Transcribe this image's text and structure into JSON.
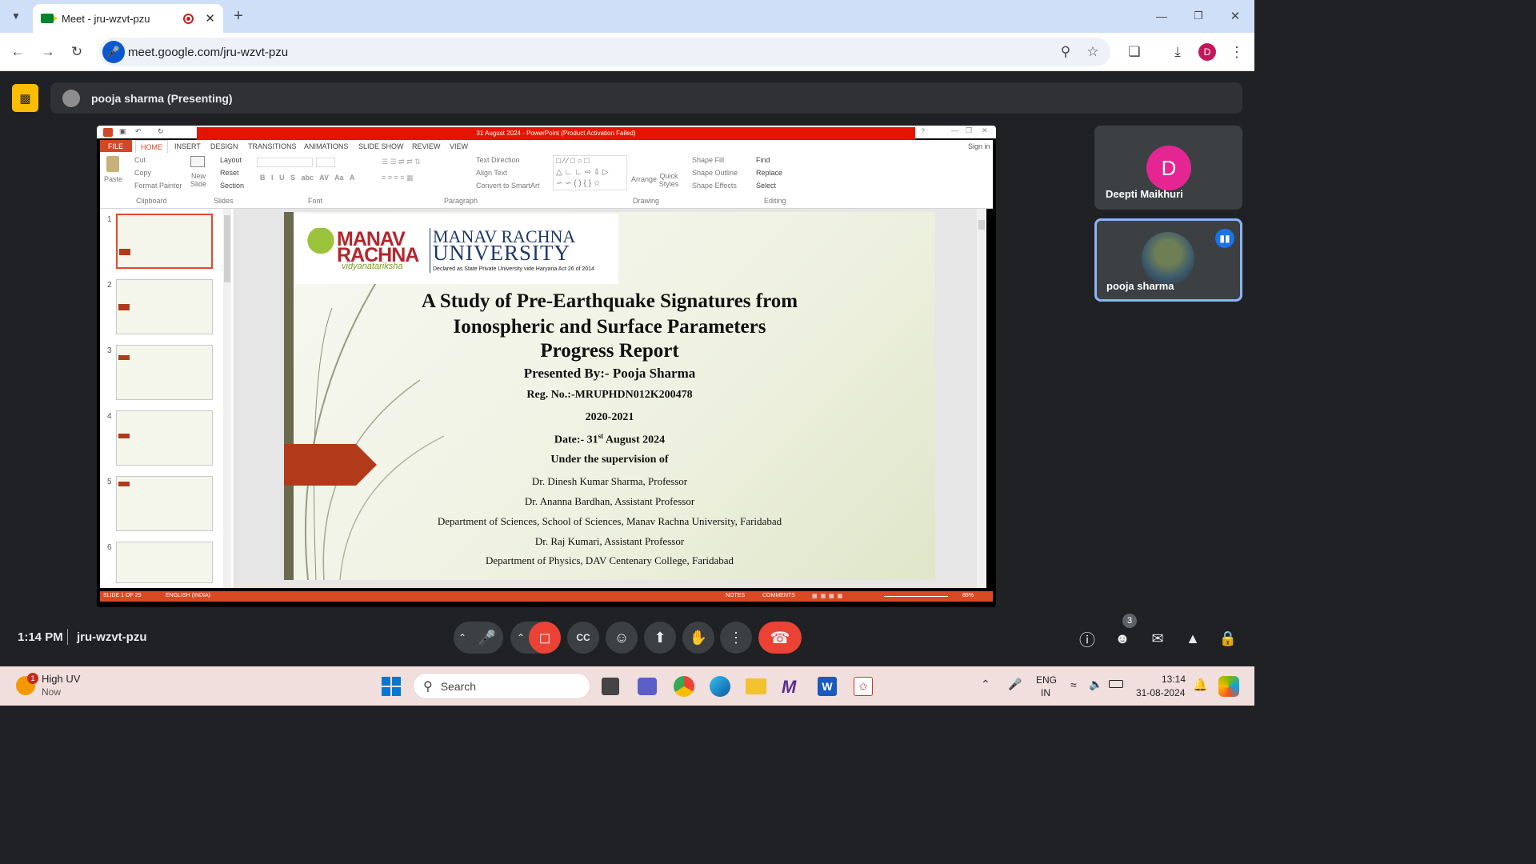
{
  "browser": {
    "tab_title": "Meet - jru-wzvt-pzu",
    "url": "meet.google.com/jru-wzvt-pzu",
    "profile_initial": "D",
    "new_tab": "+"
  },
  "meet": {
    "presenter_label": "pooja sharma (Presenting)",
    "time": "1:14 PM",
    "meeting_code": "jru-wzvt-pzu",
    "participant_count": "3",
    "participants": [
      {
        "name": "Deepti Maikhuri",
        "initial": "D",
        "color": "#e52592"
      },
      {
        "name": "pooja sharma"
      }
    ]
  },
  "powerpoint": {
    "window_title": "31 August  2024 - PowerPoint (Product Activation Failed)",
    "sign_in": "Sign in",
    "tabs": [
      "FILE",
      "HOME",
      "INSERT",
      "DESIGN",
      "TRANSITIONS",
      "ANIMATIONS",
      "SLIDE SHOW",
      "REVIEW",
      "VIEW"
    ],
    "clipboard": {
      "paste": "Paste",
      "cut": "Cut",
      "copy": "Copy",
      "format_painter": "Format Painter",
      "group": "Clipboard"
    },
    "slides_group": {
      "new_slide": "New Slide",
      "layout": "Layout",
      "reset": "Reset",
      "section": "Section",
      "group": "Slides"
    },
    "font_group": "Font",
    "paragraph": {
      "text_direction": "Text Direction",
      "align_text": "Align Text",
      "convert": "Convert to SmartArt",
      "group": "Paragraph"
    },
    "drawing": {
      "arrange": "Arrange",
      "quick_styles": "Quick Styles",
      "shape_fill": "Shape Fill",
      "shape_outline": "Shape Outline",
      "shape_effects": "Shape Effects",
      "group": "Drawing"
    },
    "editing": {
      "find": "Find",
      "replace": "Replace",
      "select": "Select",
      "group": "Editing"
    },
    "thumb_numbers": [
      "1",
      "2",
      "3",
      "4",
      "5",
      "6"
    ],
    "status": {
      "slide": "SLIDE 1 OF 29",
      "language": "ENGLISH (INDIA)",
      "notes": "NOTES",
      "comments": "COMMENTS",
      "zoom": "88%"
    }
  },
  "slide": {
    "logo_left_1": "MANAV",
    "logo_left_2": "RACHNA",
    "logo_tagline": "vidyanatariksha",
    "logo_right_1": "MANAV RACHNA",
    "logo_right_2": "UNIVERSITY",
    "logo_caption": "Declared as State Private University vide Haryana Act 26 of 2014",
    "title_1": "A Study of Pre-Earthquake Signatures from",
    "title_2": "Ionospheric and Surface Parameters",
    "subtitle": "Progress Report",
    "presented_by": "Presented By:- Pooja Sharma",
    "reg_no": "Reg. No.:-MRUPHDN012K200478",
    "year": "2020-2021",
    "date_prefix": "Date:- 31",
    "date_sup": "st",
    "date_suffix": " August 2024",
    "supervision": "Under the supervision of",
    "line_1": "Dr. Dinesh Kumar Sharma, Professor",
    "line_2": "Dr. Ananna Bardhan, Assistant Professor",
    "line_3": "Department of Sciences, School of Sciences, Manav Rachna University, Faridabad",
    "line_4": "Dr. Raj Kumari, Assistant Professor",
    "line_5": "Department of Physics, DAV Centenary College, Faridabad"
  },
  "taskbar": {
    "weather_badge": "1",
    "weather_title": "High UV",
    "weather_sub": "Now",
    "search_placeholder": "Search",
    "lang_1": "ENG",
    "lang_2": "IN",
    "clock_time": "13:14",
    "clock_date": "31-08-2024"
  }
}
